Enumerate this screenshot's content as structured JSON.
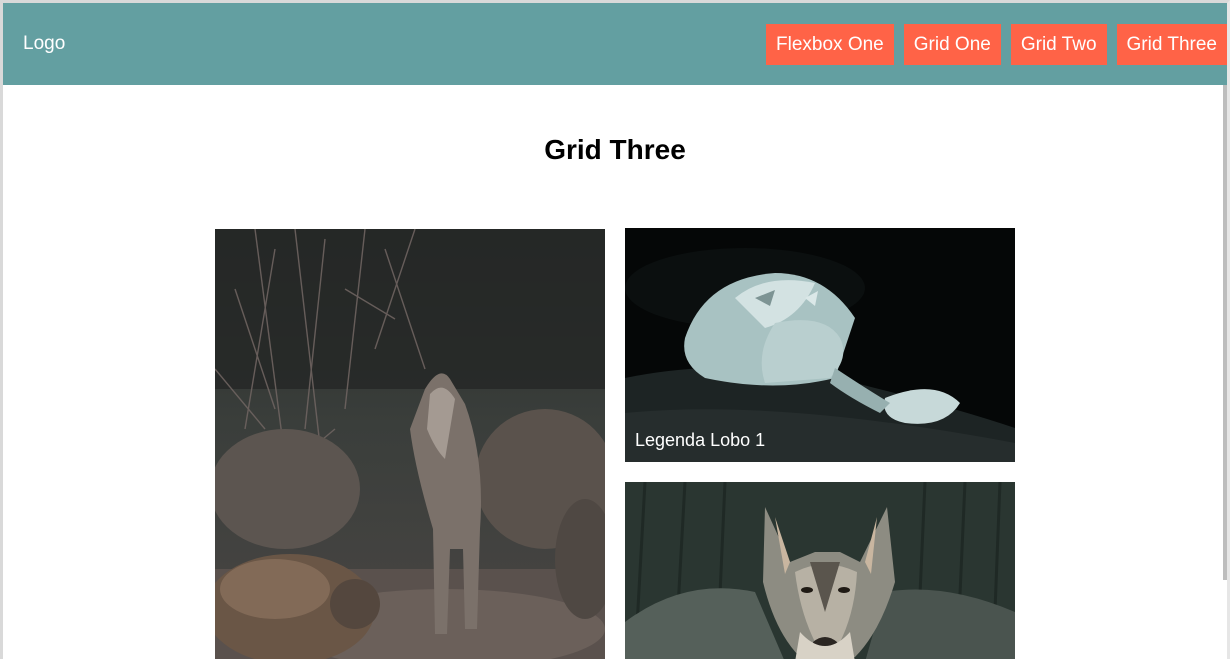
{
  "header": {
    "logo": "Logo",
    "nav": [
      {
        "label": "Flexbox One"
      },
      {
        "label": "Grid One"
      },
      {
        "label": "Grid Two"
      },
      {
        "label": "Grid Three"
      }
    ]
  },
  "main": {
    "title": "Grid Three",
    "gallery": [
      {
        "caption": ""
      },
      {
        "caption": "Legenda Lobo 1"
      },
      {
        "caption": ""
      }
    ]
  },
  "colors": {
    "header_bg": "#639fa1",
    "nav_button_bg": "#ff6347",
    "nav_button_text": "#ffffff"
  }
}
